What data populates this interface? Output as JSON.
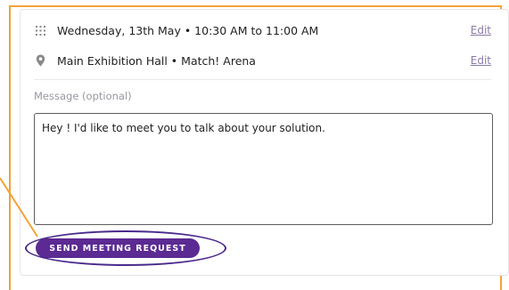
{
  "meeting": {
    "datetime": "Wednesday, 13th May • 10:30 AM to 11:00 AM",
    "location": "Main Exhibition Hall • Match! Arena",
    "edit_label": "Edit"
  },
  "message": {
    "label": "Message (optional)",
    "value": "Hey ! I'd like to meet you to talk about your solution."
  },
  "actions": {
    "send_label": "SEND MEETING REQUEST"
  },
  "icons": {
    "datetime": "calendar-icon",
    "location": "location-pin-icon"
  },
  "colors": {
    "primary": "#5b2a92",
    "highlight_frame": "#f0a33a",
    "highlight_ellipse": "#4a2a8c",
    "link": "#8a7aa6"
  }
}
